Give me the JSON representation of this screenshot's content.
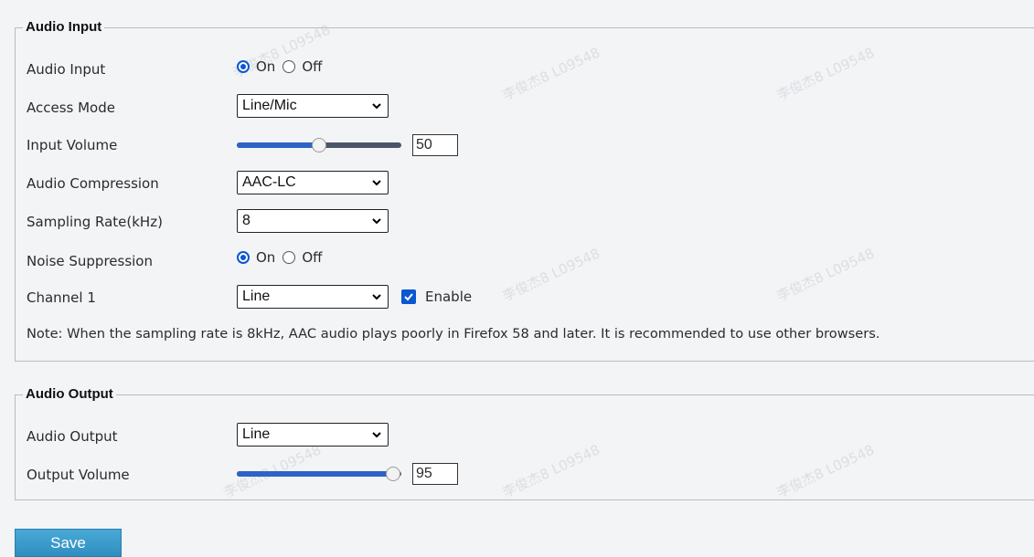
{
  "watermark": "李俊杰8 L09548",
  "audio_input": {
    "legend": "Audio Input",
    "audio_input": {
      "label": "Audio Input",
      "on": "On",
      "off": "Off",
      "selected": "on"
    },
    "access_mode": {
      "label": "Access Mode",
      "value": "Line/Mic"
    },
    "input_volume": {
      "label": "Input Volume",
      "value": "50",
      "level": 0.5
    },
    "audio_compression": {
      "label": "Audio Compression",
      "value": "AAC-LC"
    },
    "sampling_rate": {
      "label": "Sampling Rate(kHz)",
      "value": "8"
    },
    "noise_suppression": {
      "label": "Noise Suppression",
      "on": "On",
      "off": "Off",
      "selected": "on"
    },
    "channel1": {
      "label": "Channel 1",
      "value": "Line",
      "enable_label": "Enable",
      "enabled": true
    },
    "note": "Note: When the sampling rate is 8kHz, AAC audio plays poorly in Firefox 58 and later. It is recommended to use other browsers."
  },
  "audio_output": {
    "legend": "Audio Output",
    "audio_output": {
      "label": "Audio Output",
      "value": "Line"
    },
    "output_volume": {
      "label": "Output Volume",
      "value": "95",
      "level": 0.95
    }
  },
  "save_label": "Save",
  "colors": {
    "accent": "#0b57d0",
    "save_button": "#3a9bcf",
    "slider_track": "#4a5568"
  }
}
